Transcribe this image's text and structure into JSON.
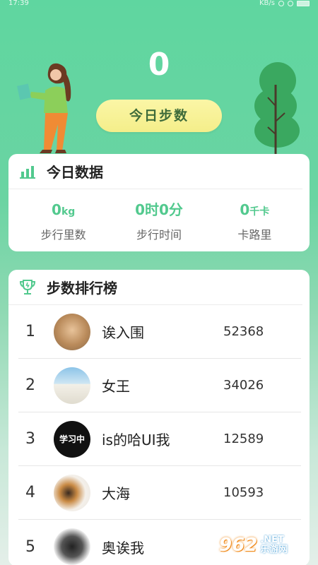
{
  "status_bar": {
    "time": "17:39",
    "speed": "KB/s"
  },
  "hero": {
    "step_count": "0",
    "today_steps_button": "今日步数"
  },
  "today_data": {
    "title": "今日数据",
    "metrics": [
      {
        "value": "0",
        "unit": "kg",
        "label": "步行里数"
      },
      {
        "value": "0时0分",
        "unit": "",
        "label": "步行时间"
      },
      {
        "value": "0",
        "unit": "千卡",
        "label": "卡路里"
      }
    ]
  },
  "leaderboard": {
    "title": "步数排行榜",
    "rows": [
      {
        "rank": "1",
        "name": "诶入围",
        "steps": "52368",
        "avatar_text": ""
      },
      {
        "rank": "2",
        "name": "女王",
        "steps": "34026",
        "avatar_text": ""
      },
      {
        "rank": "3",
        "name": "is的哈UI我",
        "steps": "12589",
        "avatar_text": "学习中"
      },
      {
        "rank": "4",
        "name": "大海",
        "steps": "10593",
        "avatar_text": ""
      },
      {
        "rank": "5",
        "name": "奥诶我",
        "steps": "",
        "avatar_text": ""
      }
    ]
  },
  "watermark": {
    "number": "962",
    "suffix_top": ".NET",
    "suffix_bottom": "乐游网"
  },
  "colors": {
    "accent_green": "#52c98e",
    "button_yellow": "#f4ee8a",
    "background_green": "#5fd6a0"
  }
}
